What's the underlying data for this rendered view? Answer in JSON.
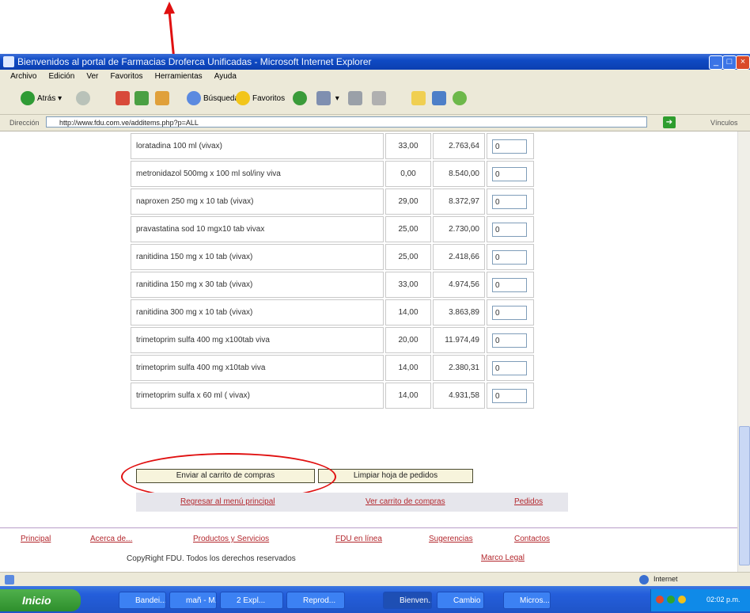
{
  "window": {
    "title": "Bienvenidos al portal de Farmacias Droferca Unificadas - Microsoft Internet Explorer"
  },
  "menu": [
    "Archivo",
    "Edición",
    "Ver",
    "Favoritos",
    "Herramientas",
    "Ayuda"
  ],
  "toolbar": {
    "back_label": "Atrás",
    "search_label": "Búsqueda",
    "favorites_label": "Favoritos"
  },
  "address": {
    "label": "Dirección",
    "url": "http://www.fdu.com.ve/additems.php?p=ALL",
    "links_label": "Vínculos"
  },
  "products": [
    {
      "name": "loratadina 100 ml (vivax)",
      "pct": "33,00",
      "price": "2.763,64",
      "qty": "0"
    },
    {
      "name": "metronidazol 500mg x 100 ml sol/iny viva",
      "pct": "0,00",
      "price": "8.540,00",
      "qty": "0"
    },
    {
      "name": "naproxen 250 mg x 10 tab (vivax)",
      "pct": "29,00",
      "price": "8.372,97",
      "qty": "0"
    },
    {
      "name": "pravastatina sod 10 mgx10 tab vivax",
      "pct": "25,00",
      "price": "2.730,00",
      "qty": "0"
    },
    {
      "name": "ranitidina 150 mg x 10 tab (vivax)",
      "pct": "25,00",
      "price": "2.418,66",
      "qty": "0"
    },
    {
      "name": "ranitidina 150 mg x 30 tab (vivax)",
      "pct": "33,00",
      "price": "4.974,56",
      "qty": "0"
    },
    {
      "name": "ranitidina 300 mg x 10 tab (vivax)",
      "pct": "14,00",
      "price": "3.863,89",
      "qty": "0"
    },
    {
      "name": "trimetoprim sulfa 400 mg x100tab viva",
      "pct": "20,00",
      "price": "11.974,49",
      "qty": "0"
    },
    {
      "name": "trimetoprim sulfa 400 mg x10tab viva",
      "pct": "14,00",
      "price": "2.380,31",
      "qty": "0"
    },
    {
      "name": "trimetoprim sulfa x 60 ml ( vivax)",
      "pct": "14,00",
      "price": "4.931,58",
      "qty": "0"
    }
  ],
  "actions": {
    "send_cart": "Enviar al carrito de compras",
    "clear_sheet": "Limpiar hoja de pedidos"
  },
  "nav": {
    "main_menu": "Regresar al menú principal",
    "view_cart": "Ver carrito de compras",
    "orders": "Pedidos"
  },
  "footer": {
    "links": [
      "Principal",
      "Acerca de...",
      "Productos y Servicios",
      "FDU en línea",
      "Sugerencias",
      "Contactos"
    ],
    "copyright": "CopyRight FDU. Todos los derechos reservados",
    "legal": "Marco Legal"
  },
  "status": {
    "zone": "Internet"
  },
  "taskbar": {
    "start": "Inicio",
    "tasks": [
      "Bandei...",
      "mañ - M...",
      "2 Expl...",
      "Reprod...",
      "Bienven...",
      "Cambio ...",
      "Micros..."
    ],
    "clock": "02:02 p.m."
  },
  "colors": {
    "annotation": "#e01010",
    "link": "#b3272d"
  }
}
